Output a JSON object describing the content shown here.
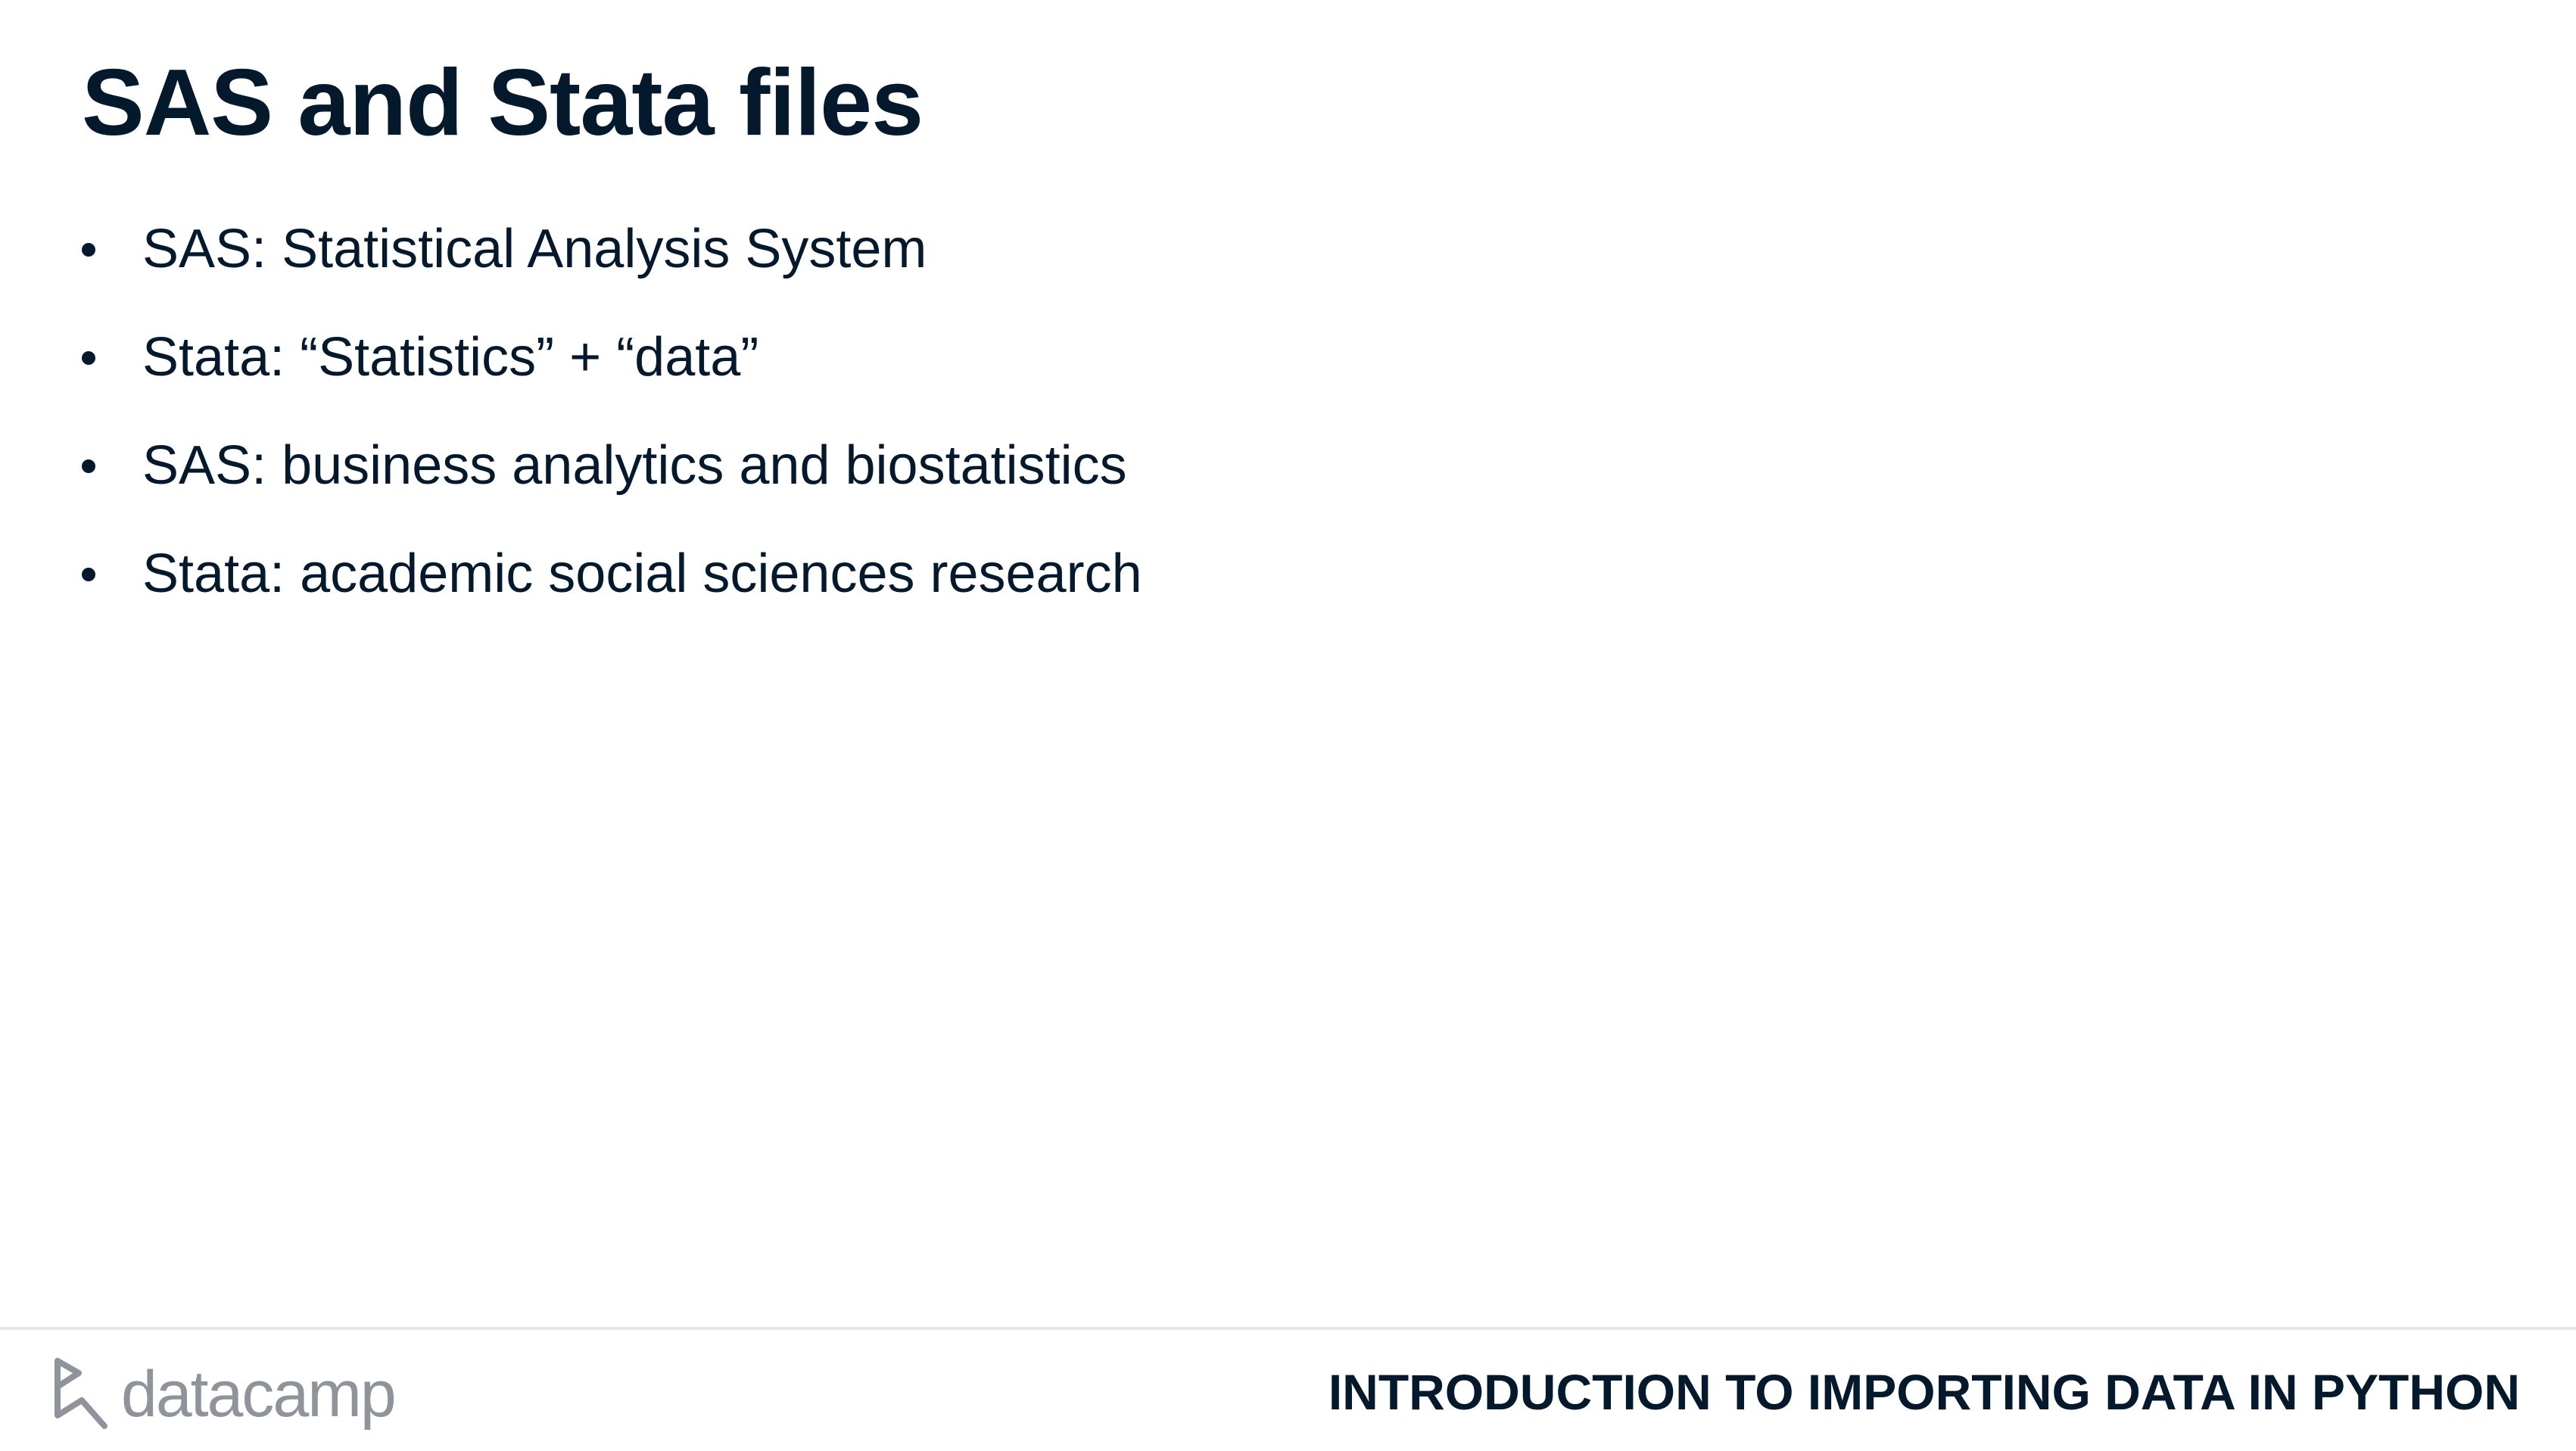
{
  "slide": {
    "title": "SAS and Stata files",
    "bullets": [
      "SAS: Statistical Analysis System",
      "Stata: “Statistics” + “data”",
      "SAS: business analytics and biostatistics",
      "Stata: academic social sciences research"
    ]
  },
  "footer": {
    "brand_name": "datacamp",
    "brand_icon": "datacamp-logo-icon",
    "course_title": "INTRODUCTION TO IMPORTING DATA IN PYTHON"
  },
  "colors": {
    "text": "#05192d",
    "brand_gray": "#8e949a",
    "divider": "#e6e6e6",
    "background": "#ffffff"
  }
}
